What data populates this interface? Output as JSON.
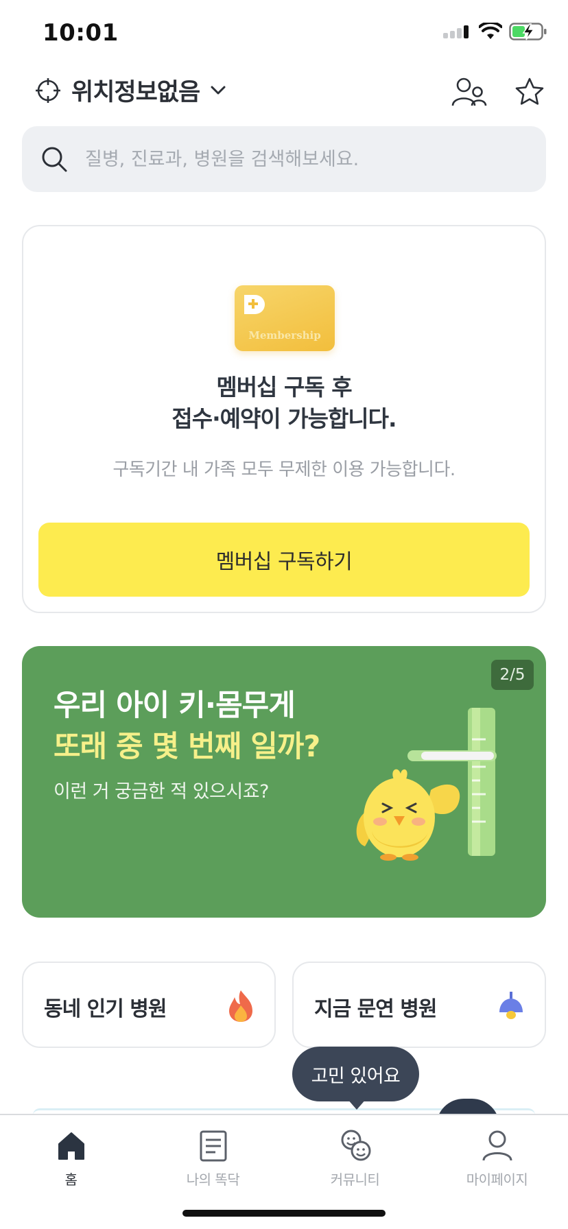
{
  "status_bar": {
    "time": "10:01",
    "icons": [
      "signal-icon",
      "wifi-icon",
      "battery-charging-icon"
    ]
  },
  "header": {
    "location_label": "위치정보없음",
    "icons": [
      "crosshair-icon",
      "chevron-down-icon",
      "family-icon",
      "star-icon"
    ]
  },
  "search": {
    "placeholder": "질병, 진료과, 병원을 검색해보세요."
  },
  "membership": {
    "badge_text": "Membership",
    "title_line1": "멤버십 구독 후",
    "title_line2": "접수·예약이 가능합니다.",
    "subtitle": "구독기간 내 가족 모두 무제한 이용 가능합니다.",
    "button_label": "멤버십 구독하기"
  },
  "banner": {
    "counter": "2/5",
    "line1": "우리 아이 키·몸무게",
    "line2": "또래 중 몇 번째 일까?",
    "subtitle": "이런 거 궁금한 적 있으시죠?",
    "colors": {
      "background": "#5c9e5a",
      "highlight": "#f6f08a"
    }
  },
  "quick_links": [
    {
      "label": "동네 인기 병원",
      "icon": "fire-icon"
    },
    {
      "label": "지금 문연 병원",
      "icon": "lamp-icon"
    }
  ],
  "tooltip": {
    "text": "고민 있어요"
  },
  "tabs": [
    {
      "label": "홈",
      "icon": "home-icon",
      "active": true
    },
    {
      "label": "나의 똑닥",
      "icon": "document-icon",
      "active": false
    },
    {
      "label": "커뮤니티",
      "icon": "community-icon",
      "active": false
    },
    {
      "label": "마이페이지",
      "icon": "person-icon",
      "active": false
    }
  ],
  "colors": {
    "accent_yellow": "#fdeb4f",
    "text_dark": "#2b2f36",
    "muted": "#a3a7ad"
  }
}
